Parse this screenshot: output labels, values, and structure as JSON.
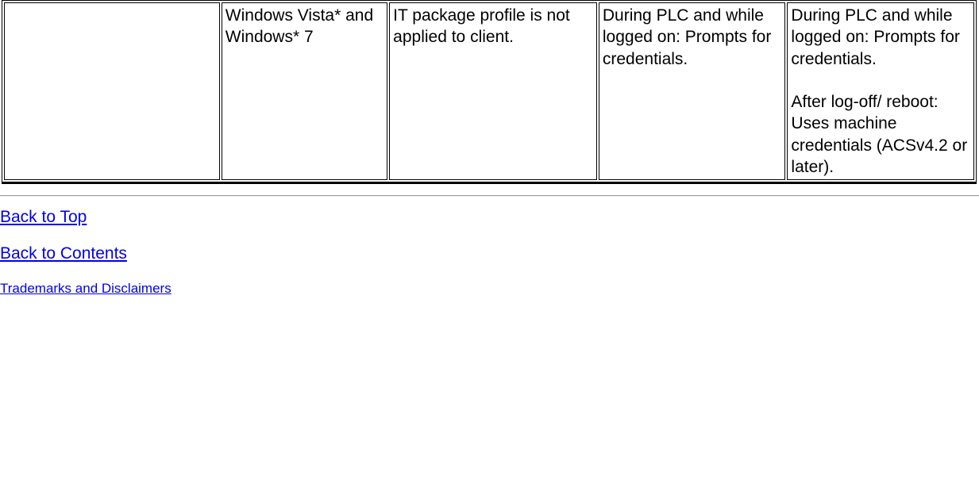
{
  "table": {
    "row": [
      "",
      "Windows Vista* and Windows* 7",
      "IT package profile is not applied to client.",
      "During PLC and while logged on: Prompts for credentials.",
      {
        "p1": "During PLC and while logged on: Prompts for credentials.",
        "p2": "After log-off/ reboot: Uses machine credentials (ACSv4.2 or later)."
      }
    ]
  },
  "links": {
    "back_to_top": "Back to Top",
    "back_to_contents": "Back to Contents",
    "trademarks": "Trademarks and Disclaimers"
  }
}
